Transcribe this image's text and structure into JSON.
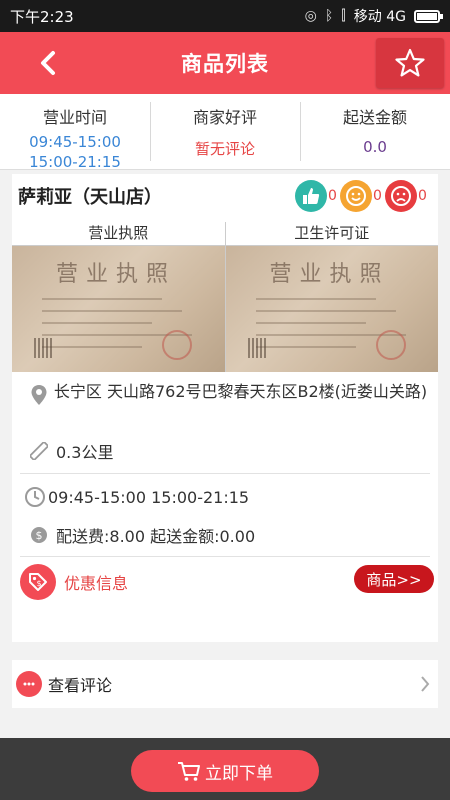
{
  "status_bar": {
    "time": "下午2:23",
    "carrier": "移动 4G"
  },
  "header": {
    "title": "商品列表",
    "back_icon": "chevron-left-icon",
    "favorite_icon": "star-icon"
  },
  "info_bar": {
    "hours_label": "营业时间",
    "hours_values": [
      "09:45-15:00",
      "15:00-21:15"
    ],
    "review_label": "商家好评",
    "review_value": "暂无评论",
    "min_label": "起送金额",
    "min_value": "0.0"
  },
  "shop": {
    "name": "萨莉亚（天山店）",
    "ratings": {
      "good": "0",
      "neutral": "0",
      "bad": "0"
    },
    "licenses": [
      {
        "title": "营业执照"
      },
      {
        "title": "卫生许可证"
      }
    ],
    "address": "长宁区 天山路762号巴黎春天东区B2楼(近娄山关路)",
    "distance": "0.3公里",
    "hours": "09:45-15:00 15:00-21:15",
    "fee": "配送费:8.00 起送金额:0.00",
    "promo_label": "优惠信息",
    "goods_button": "商品>>"
  },
  "review_link": {
    "label": "查看评论"
  },
  "bottom": {
    "order_button": "立即下单"
  },
  "colors": {
    "brand": "#f24b55",
    "accent_dark": "#c8161d",
    "hours_blue": "#3a86d6"
  }
}
